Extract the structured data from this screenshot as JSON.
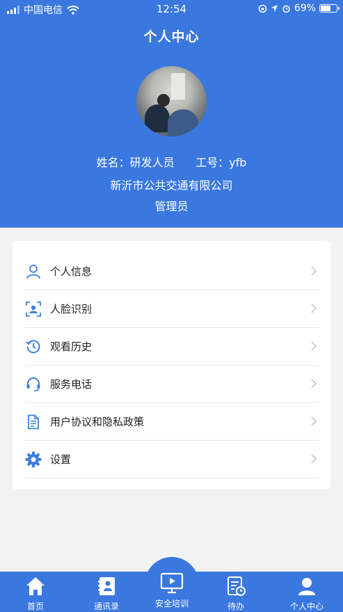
{
  "status_bar": {
    "carrier": "中国电信",
    "time": "12:54",
    "battery": "69%",
    "battery_level": 0.69
  },
  "header": {
    "title": "个人中心",
    "name_label": "姓名：",
    "name_value": "研发人员",
    "id_label": "工号：",
    "id_value": "yfb",
    "company": "新沂市公共交通有限公司",
    "role": "管理员"
  },
  "menu": [
    {
      "label": "个人信息",
      "icon": "person-icon"
    },
    {
      "label": "人脸识别",
      "icon": "face-recognition-icon"
    },
    {
      "label": "观看历史",
      "icon": "history-icon"
    },
    {
      "label": "服务电话",
      "icon": "headset-icon"
    },
    {
      "label": "用户协议和隐私政策",
      "icon": "document-icon"
    },
    {
      "label": "设置",
      "icon": "gear-icon"
    }
  ],
  "tabbar": {
    "home": "首页",
    "contacts": "通讯录",
    "training": "安全培训",
    "todo": "待办",
    "profile": "个人中心"
  },
  "colors": {
    "primary": "#3a78e0",
    "icon_blue": "#3d7fe0",
    "background": "#f2f2f2"
  }
}
